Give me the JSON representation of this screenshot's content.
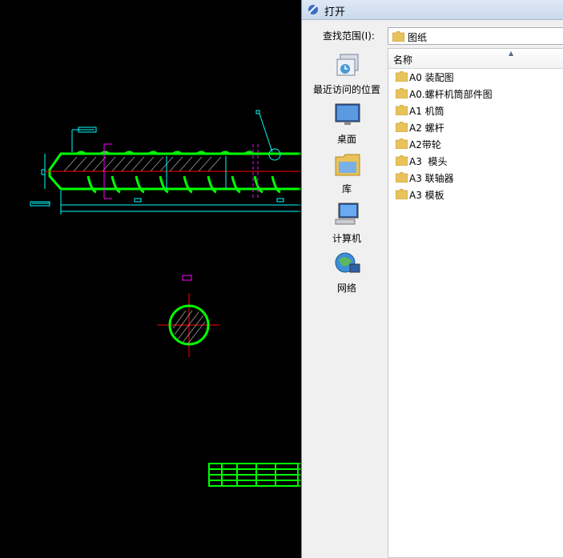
{
  "dialog": {
    "title": "打开",
    "look_in_label": "查找范围(I):",
    "look_in_value": "图纸",
    "places": [
      {
        "label": "最近访问的位置",
        "icon": "recent-places-icon"
      },
      {
        "label": "桌面",
        "icon": "desktop-icon"
      },
      {
        "label": "库",
        "icon": "libraries-icon"
      },
      {
        "label": "计算机",
        "icon": "computer-icon"
      },
      {
        "label": "网络",
        "icon": "network-icon"
      }
    ],
    "column_header": "名称",
    "files": [
      {
        "name": "A0 装配图",
        "icon": "folder-icon"
      },
      {
        "name": "A0.螺杆机筒部件图",
        "icon": "folder-icon"
      },
      {
        "name": "A1 机筒",
        "icon": "folder-icon"
      },
      {
        "name": "A2 螺杆",
        "icon": "folder-icon"
      },
      {
        "name": "A2带轮",
        "icon": "folder-icon"
      },
      {
        "name": "A3  模头",
        "icon": "folder-icon"
      },
      {
        "name": "A3 联轴器",
        "icon": "folder-icon"
      },
      {
        "name": "A3 模板",
        "icon": "folder-icon"
      }
    ]
  },
  "colors": {
    "cad_background": "#000000",
    "cad_outline": "#00ff00",
    "cad_dimension": "#00ffff",
    "cad_center": "#ff0000",
    "cad_magenta": "#ff00ff",
    "folder": "#e8c25a"
  }
}
